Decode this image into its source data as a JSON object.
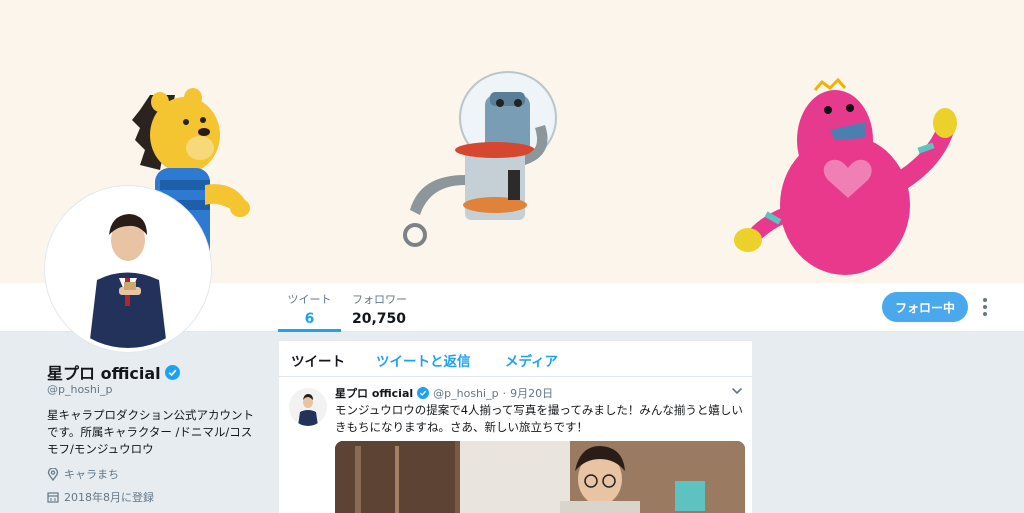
{
  "nav": {
    "stats": [
      {
        "label": "ツイート",
        "value": "6"
      },
      {
        "label": "フォロワー",
        "value": "20,750"
      }
    ],
    "follow_button": "フォロー中"
  },
  "profile": {
    "name": "星プロ official",
    "handle": "@p_hoshi_p",
    "bio": "星キャラプロダクション公式アカウントです。所属キャラクター /ドニマル/コスモフ/モンジュウロウ",
    "location": "キャラまち",
    "joined": "2018年8月に登録"
  },
  "timeline": {
    "tabs": [
      "ツイート",
      "ツイートと返信",
      "メディア"
    ],
    "tweet": {
      "name": "星プロ official",
      "handle": "@p_hoshi_p",
      "dot": "·",
      "date": "9月20日",
      "text": "モンジュウロウの提案で4人揃って写真を撮ってみました！みんな揃うと嬉しいきもちになりますね。さあ、新しい旅立ちです！"
    }
  },
  "colors": {
    "accent": "#1da1f2",
    "follow_button": "#4aa8ec",
    "page_background": "#e6ecf0",
    "banner_background": "#fbf5ec"
  },
  "icons": [
    "verified-badge-icon",
    "location-pin-icon",
    "calendar-icon",
    "more-vertical-icon",
    "chevron-down-icon"
  ]
}
